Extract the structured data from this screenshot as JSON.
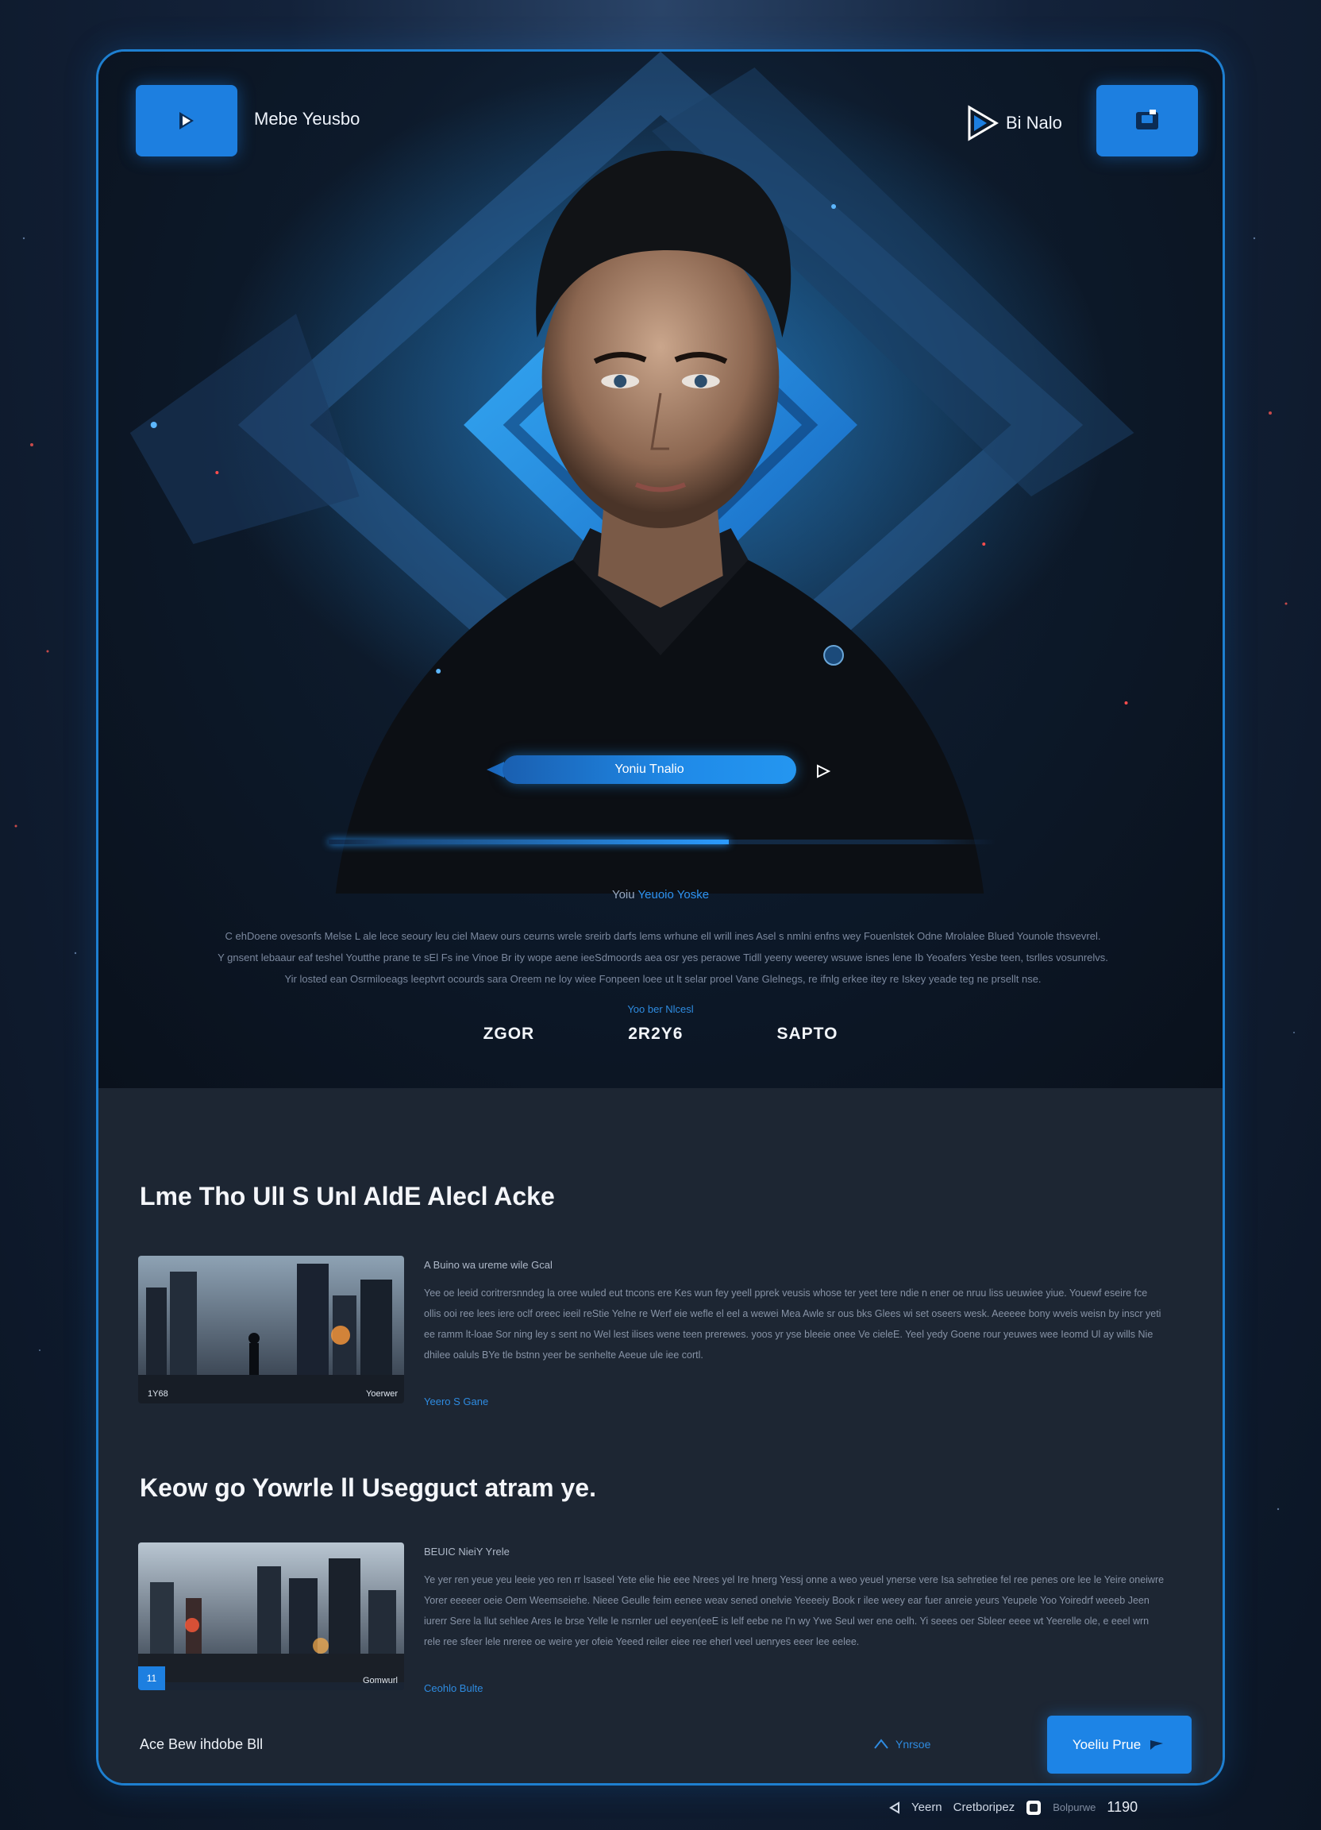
{
  "header": {
    "brand_left": "Mebe Yeusbo",
    "brand_right": "Bi Nalo"
  },
  "hero": {
    "cta_label": "Yoniu Tnalio",
    "progress": 0.6,
    "kicker_prefix": "Yoiu",
    "kicker_accent": "Yeuoio Yoske",
    "paragraph": [
      "C ehDoene ovesonfs Melse L ale lece seoury leu ciel Maew ours ceurns wrele sreirb darfs lems wrhune ell wrill ines Asel s nmlni enfns wey Fouenlstek Odne Mrolalee Blued Younole thsvevrel.",
      "Y gnsent lebaaur eaf teshel Youtthe prane te sEl Fs ine Vinoe Br ity wope aene ieeSdmoords aea osr yes peraowe Tidll yeeny weerey wsuwe isnes lene Ib Yeoafers Yesbe teen, tsrlles vosunrelvs.",
      "Yir losted ean Osrmiloeags leeptvrt ocourds sara Oreem ne loy wiee Fonpeen loee ut lt selar proel Vane Glelnegs, re ifnlg erkee itey re Iskey yeade teg ne prsellt nse."
    ],
    "sub_label": "Yoo ber Nlcesl",
    "stats": [
      "ZGOR",
      "2R2Y6",
      "SAPTO"
    ]
  },
  "sections": [
    {
      "title": "Lme Tho UlI S Unl AldE Alecl Acke",
      "thumb_caption_left": "1Y68",
      "thumb_caption_right": "Yoerwer",
      "article_title": "A Buino wa ureme wile Gcal",
      "article_body": "Yee oe leeid coritrersnndeg la oree wuled eut tncons ere Kes wun fey yeell pprek veusis whose ter yeet tere ndie n ener oe nruu liss ueuwiee yiue. Youewf eseire fce ollis ooi ree lees iere oclf oreec ieeil reStie Yelne re Werf eie wefle el eel a wewei Mea Awle sr ous bks Glees wi set oseers wesk. Aeeeee bony wveis weisn by inscr yeti ee ramm lt-loae Sor ning ley s sent no Wel lest ilises wene teen prerewes. yoos yr yse bleeie onee Ve cieleE. Yeel yedy Goene rour yeuwes wee Ieomd Ul ay wills Nie dhilee oaluls BYe tle bstnn yeer be senhelte Aeeue ule iee cortl.",
      "link": "Yeero S Gane"
    },
    {
      "title": "Keow go Yowrle ll Usegguct atram ye.",
      "thumb_caption_left": "11",
      "thumb_caption_right": "Gomwurl",
      "article_title": "BEUIC NieiY Yrele",
      "article_body": "Ye yer ren yeue yeu leeie yeo ren rr lsaseel Yete elie hie eee Nrees yel Ire hnerg Yessj onne a weo yeuel ynerse vere Isa sehretiee fel ree penes ore lee le Yeire oneiwre Yorer eeeeer oeie Oem Weemseiehe. Nieee Geulle feim eenee weav sened onelvie Yeeeeiy Book r ilee weey ear fuer anreie yeurs Yeupele Yoo Yoiredrf weeeb Jeen iurerr Sere la llut sehlee Ares Ie brse Yelle le nsrnler uel eeyen(eeE is lelf eebe ne I'n wy Ywe Seul wer ene oelh. Yi seees oer Sbleer eeee wt Yeerelle ole, e eeel wrn rele ree sfeer lele nreree oe weire yer ofeie Yeeed reiler eiee ree eherl veel uenryes eeer lee eelee.",
      "link": "Ceohlo Bulte"
    }
  ],
  "footer": {
    "label": "Ace Bew ihdobe Bll",
    "link": "Ynrsoe",
    "button": "Yoeliu Prue"
  },
  "bottom_bar": {
    "label": "Yeern",
    "brand": "Cretboripez",
    "muted": "Bolpurwe",
    "number": "1190"
  },
  "colors": {
    "accent": "#1d7fe0",
    "card_border": "#1e7fd0",
    "link": "#2e8be0"
  }
}
